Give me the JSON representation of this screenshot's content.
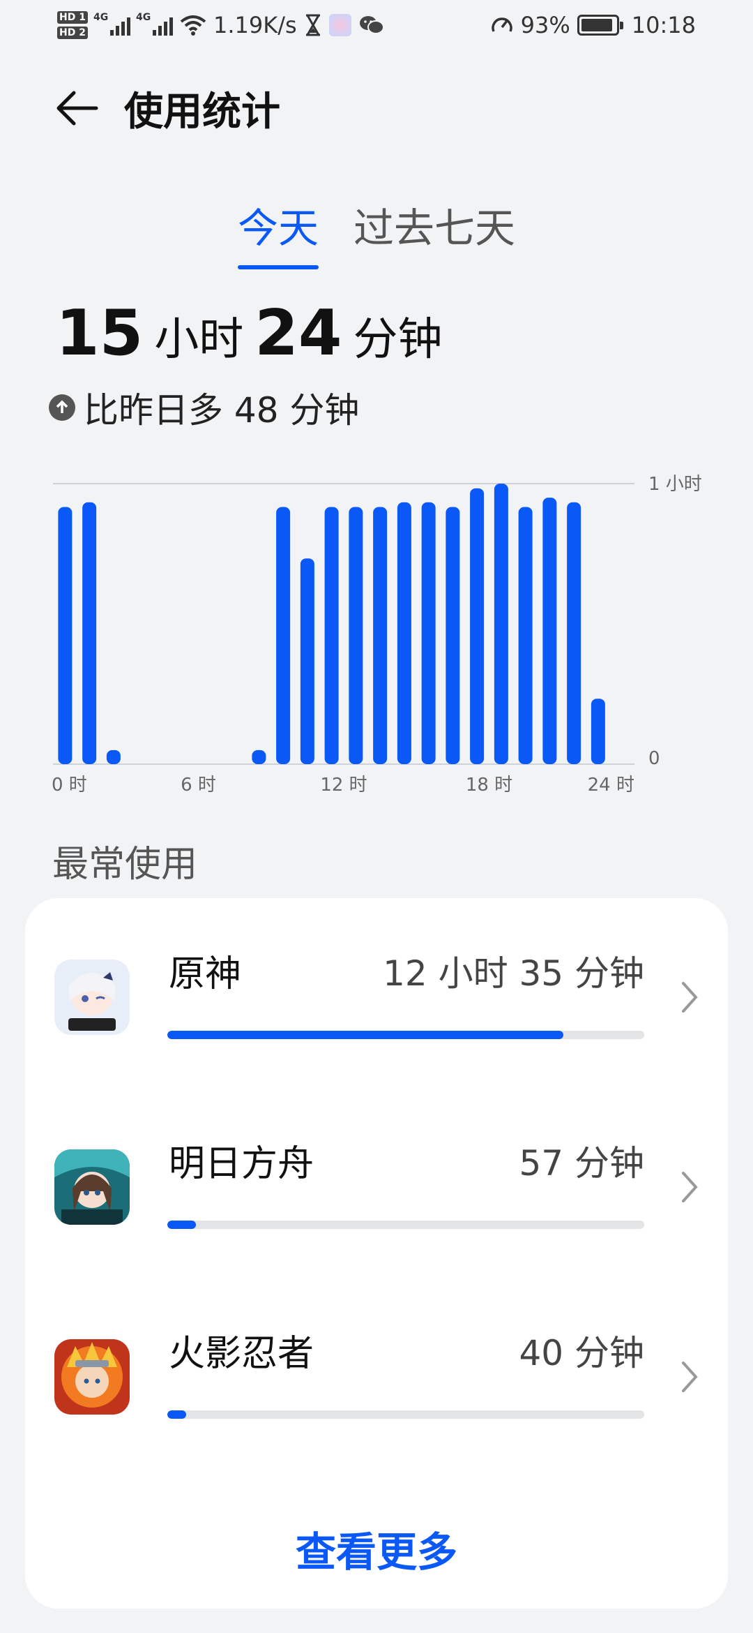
{
  "status_bar": {
    "hd1": "HD 1",
    "hd2": "HD 2",
    "net1": "4G",
    "net2": "4G",
    "speed": "1.19K/s",
    "battery": "93%",
    "battery_level": 0.93,
    "time": "10:18"
  },
  "header": {
    "title": "使用统计",
    "back_icon": "back-arrow-icon"
  },
  "tabs": [
    {
      "label": "今天",
      "active": true
    },
    {
      "label": "过去七天",
      "active": false
    }
  ],
  "summary": {
    "hours": "15",
    "hours_unit": "小时",
    "minutes": "24",
    "minutes_unit": "分钟",
    "compare_text": "比昨日多 48 分钟",
    "compare_icon": "arrow-up-circle-icon"
  },
  "chart_data": {
    "type": "bar",
    "unit": "minutes",
    "y_max_label": "1 小时",
    "y_min_label": "0",
    "ylim": [
      0,
      60
    ],
    "x_tick_labels": [
      "0 时",
      "6 时",
      "12 时",
      "18 时",
      "24 时"
    ],
    "categories": [
      "0",
      "1",
      "2",
      "3",
      "4",
      "5",
      "6",
      "7",
      "8",
      "9",
      "10",
      "11",
      "12",
      "13",
      "14",
      "15",
      "16",
      "17",
      "18",
      "19",
      "20",
      "21",
      "22",
      "23"
    ],
    "values": [
      55,
      56,
      3,
      0,
      0,
      0,
      0,
      0,
      3,
      55,
      44,
      55,
      55,
      55,
      56,
      56,
      55,
      59,
      60,
      55,
      57,
      56,
      14,
      0
    ],
    "color": "#0a59f7",
    "grid": true
  },
  "most_used": {
    "title": "最常使用",
    "apps": [
      {
        "name": "原神",
        "time": "12 小时 35 分钟",
        "fraction": 0.83,
        "icon": "genshin-app-icon"
      },
      {
        "name": "明日方舟",
        "time": "57 分钟",
        "fraction": 0.06,
        "icon": "arknights-app-icon"
      },
      {
        "name": "火影忍者",
        "time": "40 分钟",
        "fraction": 0.04,
        "icon": "naruto-app-icon"
      }
    ],
    "see_more": "查看更多"
  },
  "colors": {
    "accent": "#0a59f7",
    "background": "#f1f3f5",
    "card": "#ffffff",
    "track": "#e3e4e6"
  }
}
